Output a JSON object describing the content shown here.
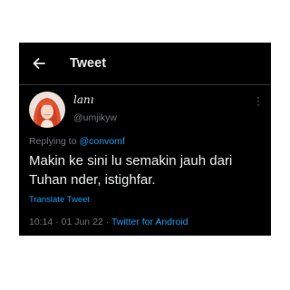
{
  "header": {
    "title": "Tweet",
    "back_icon": "arrow-left-icon"
  },
  "author": {
    "display_name": "lanı",
    "handle": "@umjikyw",
    "avatar_icon": "profile-photo"
  },
  "more_icon": "more-vertical-icon",
  "reply": {
    "prefix": "Replying to",
    "mention": "@convomf"
  },
  "tweet": {
    "text": "Makin ke sini lu semakin jauh dari Tuhan nder, istighfar.",
    "translate_label": "Translate Tweet"
  },
  "meta": {
    "time": "10:14",
    "date": "01 Jun 22",
    "separator": "·",
    "source": "Twitter for Android"
  },
  "colors": {
    "background": "#000000",
    "text": "#e7e9ea",
    "secondary_text": "#71767b",
    "accent": "#1d9bf0",
    "divider": "#2f3336"
  }
}
